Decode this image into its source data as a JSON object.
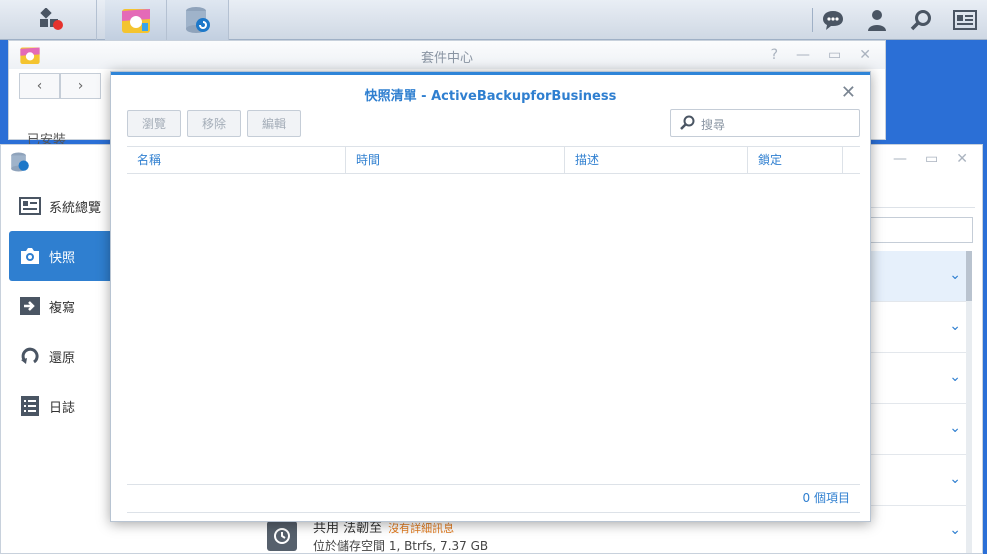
{
  "taskbar": {
    "apps": [
      {
        "name": "main-menu-icon"
      },
      {
        "name": "package-center-icon"
      },
      {
        "name": "snapshot-replication-icon"
      }
    ],
    "right_icons": [
      "chat-icon",
      "user-icon",
      "search-icon",
      "widgets-icon"
    ]
  },
  "package_center": {
    "title": "套件中心",
    "installed_label": "已安裝"
  },
  "app": {
    "sidebar": [
      {
        "label": "系統總覽",
        "icon": "overview-icon"
      },
      {
        "label": "快照",
        "icon": "camera-icon",
        "active": true
      },
      {
        "label": "複寫",
        "icon": "replication-icon"
      },
      {
        "label": "還原",
        "icon": "restore-icon"
      },
      {
        "label": "日誌",
        "icon": "log-icon"
      }
    ],
    "task": {
      "name": "共用 法韌至",
      "status": "沒有詳細訊息",
      "sub": "位於儲存空間 1, Btrfs, 7.37 GB"
    }
  },
  "modal": {
    "title": "快照清單 - ActiveBackupforBusiness",
    "toolbar": {
      "browse": "瀏覽",
      "remove": "移除",
      "edit": "編輯"
    },
    "search_placeholder": "搜尋",
    "columns": [
      "名稱",
      "時間",
      "描述",
      "鎖定"
    ],
    "rows": [],
    "count_label": "0 個項目"
  },
  "colors": {
    "accent": "#2f7fd0",
    "desktop": "#2b6fd6"
  }
}
